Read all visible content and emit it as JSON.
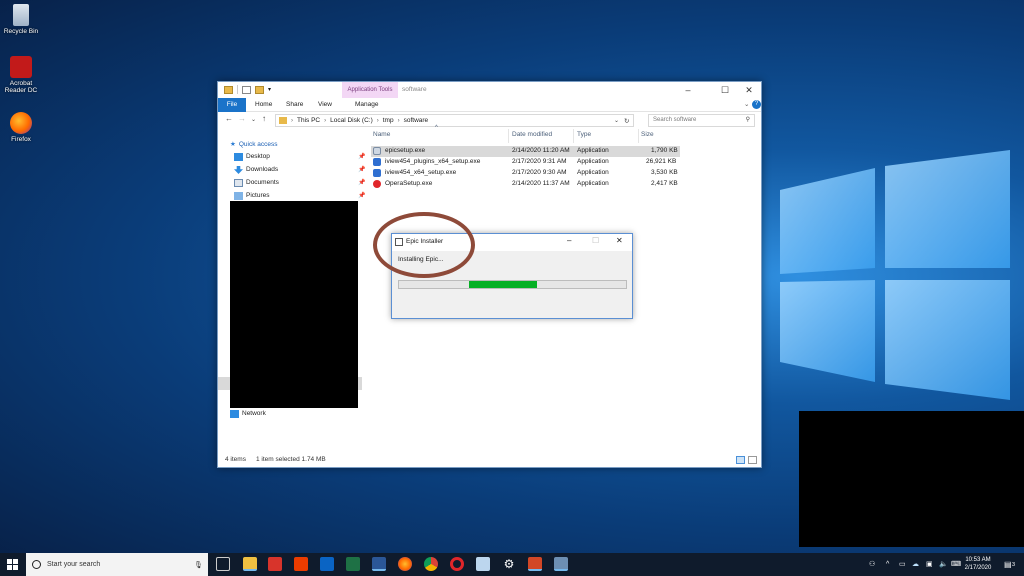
{
  "desktop": {
    "icons": [
      {
        "label": "Recycle Bin",
        "icon": "recycle-bin-icon"
      },
      {
        "label": "Acrobat Reader DC",
        "icon": "acrobat-icon"
      },
      {
        "label": "Firefox",
        "icon": "firefox-icon"
      }
    ]
  },
  "explorer": {
    "context_tab": "Application Tools",
    "title": "software",
    "ribbon_tabs": [
      "File",
      "Home",
      "Share",
      "View",
      "Manage"
    ],
    "breadcrumb": [
      "This PC",
      "Local Disk (C:)",
      "tmp",
      "software"
    ],
    "search_placeholder": "Search software",
    "nav": {
      "quick_access": "Quick access",
      "items": [
        {
          "label": "Desktop",
          "icon": "desktop-icon"
        },
        {
          "label": "Downloads",
          "icon": "downloads-icon"
        },
        {
          "label": "Documents",
          "icon": "documents-icon"
        },
        {
          "label": "Pictures",
          "icon": "pictures-icon"
        }
      ],
      "network": "Network"
    },
    "columns": [
      "Name",
      "Date modified",
      "Type",
      "Size"
    ],
    "files": [
      {
        "name": "epicsetup.exe",
        "date": "2/14/2020 11:20 AM",
        "type": "Application",
        "size": "1,790 KB",
        "selected": true
      },
      {
        "name": "iview454_plugins_x64_setup.exe",
        "date": "2/17/2020 9:31 AM",
        "type": "Application",
        "size": "26,921 KB",
        "selected": false
      },
      {
        "name": "iview454_x64_setup.exe",
        "date": "2/17/2020 9:30 AM",
        "type": "Application",
        "size": "3,530 KB",
        "selected": false
      },
      {
        "name": "OperaSetup.exe",
        "date": "2/14/2020 11:37 AM",
        "type": "Application",
        "size": "2,417 KB",
        "selected": false
      }
    ],
    "status": {
      "count": "4 items",
      "selection": "1 item selected  1.74 MB"
    }
  },
  "installer": {
    "title": "Epic Installer",
    "message": "Installing Epic...",
    "progress": 0.3
  },
  "taskbar": {
    "search_placeholder": "Start your search",
    "time": "10:53 AM",
    "date": "2/17/2020",
    "notification_count": "3",
    "accent": "#0078d7"
  }
}
